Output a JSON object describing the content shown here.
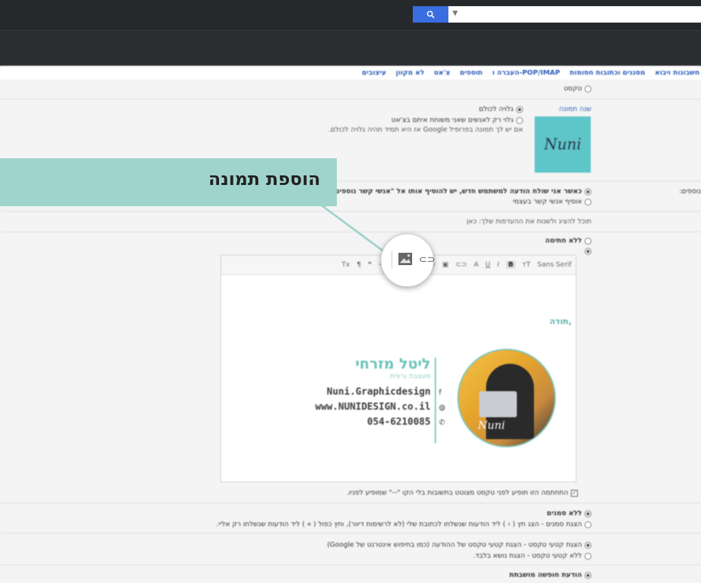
{
  "nav": {
    "tabs": [
      "חשבונות ויבוא",
      "מסננים וכתובות חסומות",
      "העברה ו-POP/IMAP",
      "תוספים",
      "צ'אט",
      "לא מקוון",
      "עיצובים"
    ]
  },
  "settings": {
    "row_text": "טקסט",
    "picture_label": "שנה תמונה",
    "visible_all": "גלויה לכולם",
    "visible_contacts": "גלוי רק לאנשים שאני משוחח איתם בצ'אט",
    "google_note": "אם יש לך תמונה בפרופיל Google אז היא תמיד תהיה גלויה לכולם.",
    "contacts_opt1": "כאשר אני שולח הודעה למשתמש חדש, יש להוסיף אותו אל \"אנשי קשר נוספים\" כדי שההשלמה האוטומטית תפעל בפעם הבאה",
    "contacts_opt2": "אוסיף אנשי קשר בעצמי",
    "left_edge_label": "נוספים:",
    "learn_more": "תוכל להציג ולשנות את ההעדפות שלך: כאן",
    "no_signature": "ללא חתימה",
    "signature_note": "התחתמה הזו תופיע לפני טקסט מצוטט בתשובות בלי הקו \"--\" שמופיע לפניו.",
    "no_markers": "ללא סמנים",
    "show_markers": "הצגת סמנים - הצג חץ ( › ) ליד הודעות שנשלחו לכתובת שלי (לא לרשימות דיוור), וחץ כפול ( » ) ליד הודעות שנשלחו רק אליי.",
    "snippets_on": "הצגת קטעי טקסט - הצגת קטעי טקסט של ההודעה (כמו בחיפוש אינטרנט של Google)",
    "snippets_off": "ללא קטעי טקסט - הצגת נושא בלבד.",
    "vacation": "הודעת חופשה מושבתת"
  },
  "editor": {
    "font_label": "Sans Serif",
    "thanks": "תודה,"
  },
  "signature": {
    "name": "ליטל מזרחי",
    "subtitle": "מעצבת גרפית",
    "facebook": "Nuni.Graphicdesign",
    "website": "www.NUNIDESIGN.co.il",
    "phone": "054-6210085",
    "avatar_text": "Nuni",
    "logo_text": "Nuni"
  },
  "callout": {
    "text": "הוספת תמונה"
  },
  "colors": {
    "accent": "#9fd4cc",
    "brand_teal": "#6cc2b9",
    "link": "#2b5db8",
    "topbar": "#26292c"
  }
}
